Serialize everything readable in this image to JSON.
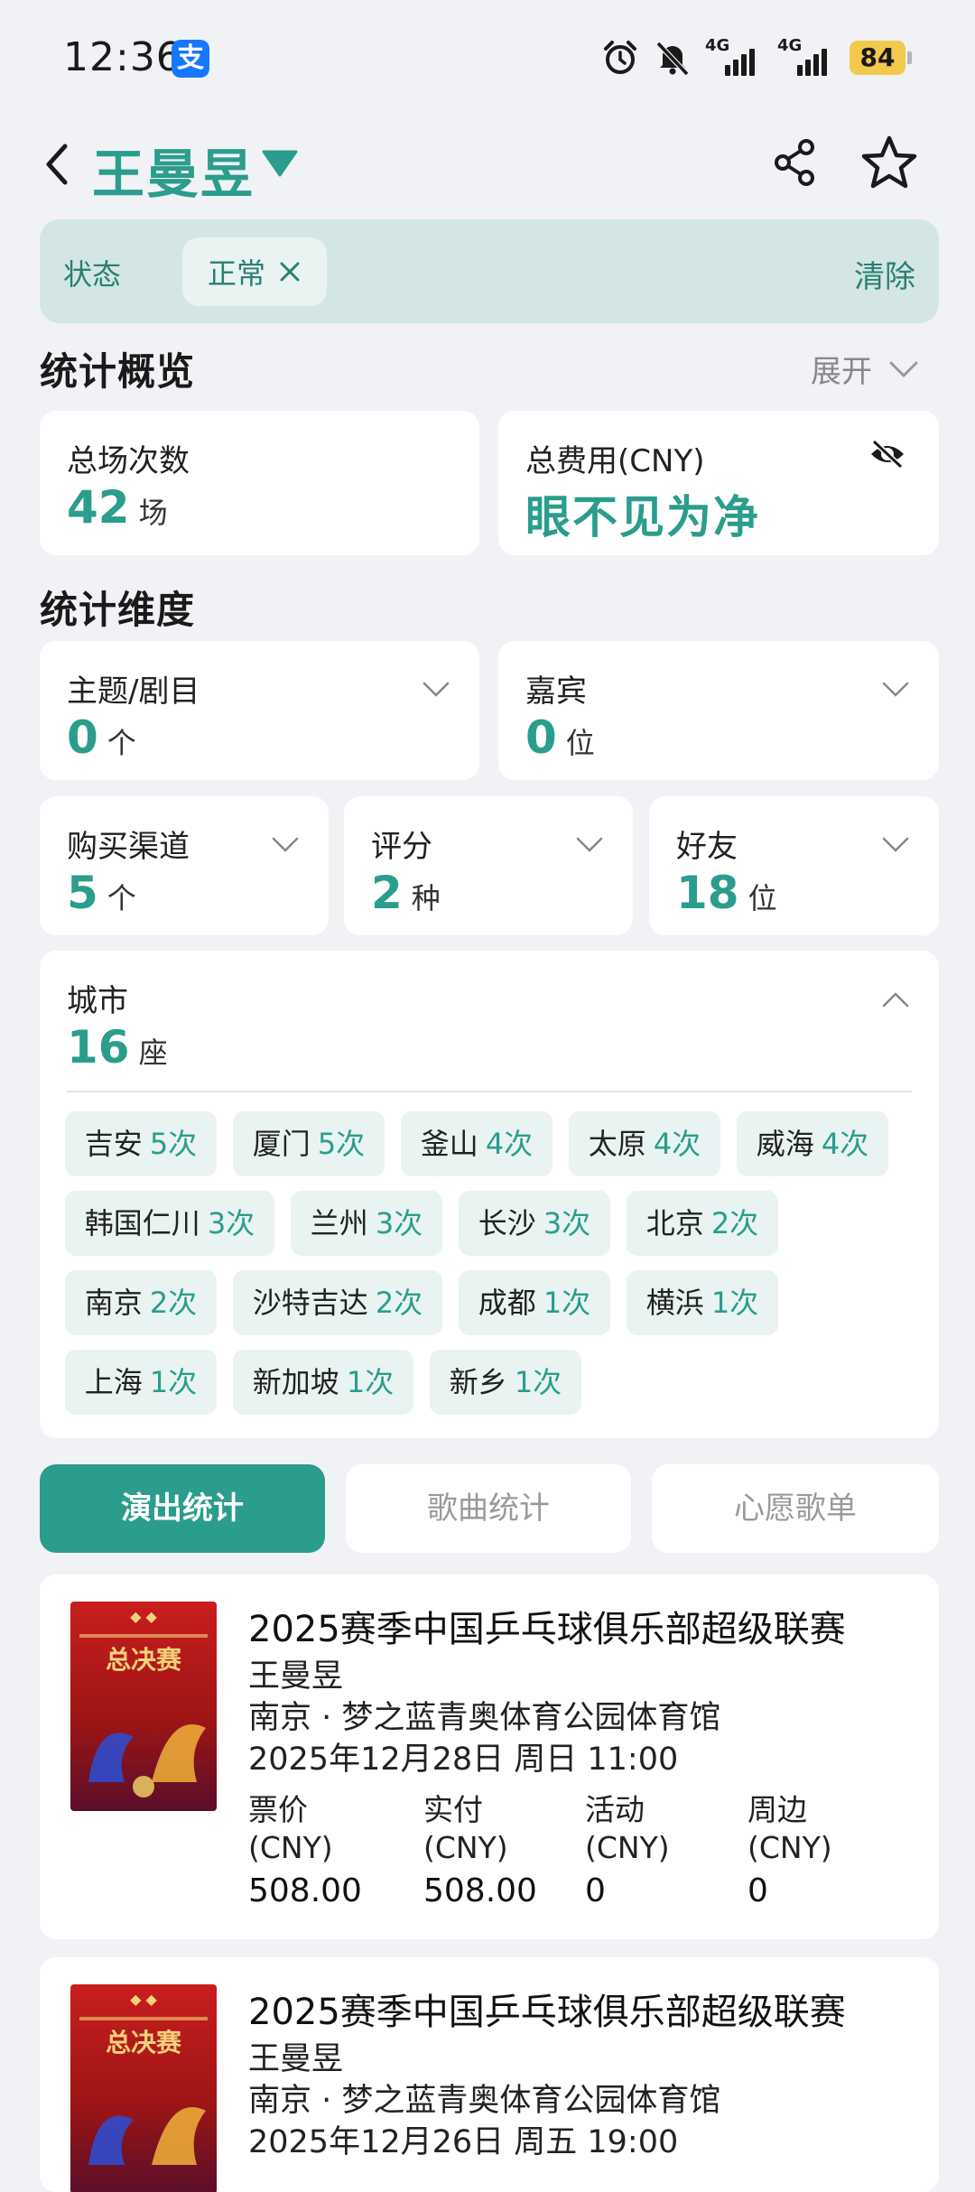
{
  "status_bar": {
    "time": "12:36",
    "app_badge": "支",
    "network_1": "4G",
    "network_2": "4G",
    "battery": "84"
  },
  "header": {
    "title": "王曼昱"
  },
  "filter": {
    "label": "状态",
    "chip": "正常",
    "clear": "清除"
  },
  "overview": {
    "title": "统计概览",
    "expand_label": "展开",
    "total_count_label": "总场次数",
    "total_count_value": "42",
    "total_count_unit": "场",
    "total_cost_label": "总费用(CNY)",
    "total_cost_value": "眼不见为净"
  },
  "dimensions": {
    "title": "统计维度",
    "items": [
      {
        "label": "主题/剧目",
        "value": "0",
        "unit": "个"
      },
      {
        "label": "嘉宾",
        "value": "0",
        "unit": "位"
      },
      {
        "label": "购买渠道",
        "value": "5",
        "unit": "个"
      },
      {
        "label": "评分",
        "value": "2",
        "unit": "种"
      },
      {
        "label": "好友",
        "value": "18",
        "unit": "位"
      }
    ],
    "city": {
      "label": "城市",
      "value": "16",
      "unit": "座",
      "chips": [
        {
          "name": "吉安",
          "count": "5次"
        },
        {
          "name": "厦门",
          "count": "5次"
        },
        {
          "name": "釜山",
          "count": "4次"
        },
        {
          "name": "太原",
          "count": "4次"
        },
        {
          "name": "威海",
          "count": "4次"
        },
        {
          "name": "韩国仁川",
          "count": "3次"
        },
        {
          "name": "兰州",
          "count": "3次"
        },
        {
          "name": "长沙",
          "count": "3次"
        },
        {
          "name": "北京",
          "count": "2次"
        },
        {
          "name": "南京",
          "count": "2次"
        },
        {
          "name": "沙特吉达",
          "count": "2次"
        },
        {
          "name": "成都",
          "count": "1次"
        },
        {
          "name": "横浜",
          "count": "1次"
        },
        {
          "name": "上海",
          "count": "1次"
        },
        {
          "name": "新加坡",
          "count": "1次"
        },
        {
          "name": "新乡",
          "count": "1次"
        }
      ]
    }
  },
  "tabs": [
    {
      "label": "演出统计",
      "active": true
    },
    {
      "label": "歌曲统计",
      "active": false
    },
    {
      "label": "心愿歌单",
      "active": false
    }
  ],
  "events": [
    {
      "title": "2025赛季中国乒乓球俱乐部超级联赛",
      "artist": "王曼昱",
      "venue": "南京 · 梦之蓝青奥体育公园体育馆",
      "datetime": "2025年12月28日 周日 11:00",
      "poster_text": "总决赛",
      "prices": [
        {
          "label": "票价",
          "currency": "(CNY)",
          "value": "508.00"
        },
        {
          "label": "实付",
          "currency": "(CNY)",
          "value": "508.00"
        },
        {
          "label": "活动",
          "currency": "(CNY)",
          "value": "0"
        },
        {
          "label": "周边",
          "currency": "(CNY)",
          "value": "0"
        }
      ]
    },
    {
      "title": "2025赛季中国乒乓球俱乐部超级联赛",
      "artist": "王曼昱",
      "venue": "南京 · 梦之蓝青奥体育公园体育馆",
      "datetime": "2025年12月26日 周五 19:00",
      "poster_text": "总决赛"
    }
  ],
  "colors": {
    "accent": "#2a9d8c",
    "background": "#f1f2f6",
    "chip_bg": "#e8f3f2",
    "filter_bg": "#d4e6e3"
  }
}
